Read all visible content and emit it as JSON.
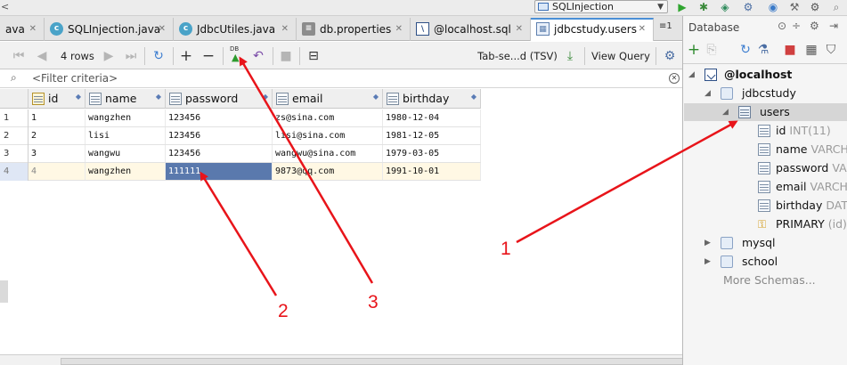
{
  "toolbar": {
    "run_config": "SQLInjection"
  },
  "tabs": [
    {
      "label": "ava",
      "icon": "none"
    },
    {
      "label": "SQLInjection.java",
      "icon": "class-icon"
    },
    {
      "label": "JdbcUtiles.java",
      "icon": "class-icon"
    },
    {
      "label": "db.properties",
      "icon": "properties-icon"
    },
    {
      "label": "@localhost.sql",
      "icon": "console-icon"
    },
    {
      "label": "jdbcstudy.users",
      "icon": "table-icon",
      "active": true
    }
  ],
  "tab_overflow": "≡1",
  "grid_toolbar": {
    "rows_label": "4 rows",
    "format_label": "Tab-se...d (TSV)",
    "view_query_label": "View Query",
    "submit_icon_label": "DB"
  },
  "filter": {
    "placeholder": "<Filter criteria>"
  },
  "grid": {
    "columns": [
      "id",
      "name",
      "password",
      "email",
      "birthday"
    ],
    "rows": [
      {
        "num": "1",
        "cells": [
          "1",
          "wangzhen",
          "123456",
          "zs@sina.com",
          "1980-12-04"
        ]
      },
      {
        "num": "2",
        "cells": [
          "2",
          "lisi",
          "123456",
          "lisi@sina.com",
          "1981-12-05"
        ]
      },
      {
        "num": "3",
        "cells": [
          "3",
          "wangwu",
          "123456",
          "wangwu@sina.com",
          "1979-03-05"
        ]
      },
      {
        "num": "4",
        "cells": [
          "4",
          "wangzhen",
          "111111",
          "9873@qq.com",
          "1991-10-01"
        ]
      }
    ]
  },
  "db_panel": {
    "title": "Database",
    "connection": "@localhost",
    "schema": "jdbcstudy",
    "table": "users",
    "columns": [
      {
        "name": "id",
        "type": "INT(11)"
      },
      {
        "name": "name",
        "type": "VARCHAR"
      },
      {
        "name": "password",
        "type": "VARCHAR"
      },
      {
        "name": "email",
        "type": "VARCHAR"
      },
      {
        "name": "birthday",
        "type": "DATE"
      }
    ],
    "key": {
      "name": "PRIMARY",
      "type": "(id)"
    },
    "other_schemas": [
      "mysql",
      "school"
    ],
    "more_schemas": "More Schemas..."
  },
  "annotations": {
    "labels": [
      "1",
      "2",
      "3"
    ],
    "color": "#e8141a"
  }
}
